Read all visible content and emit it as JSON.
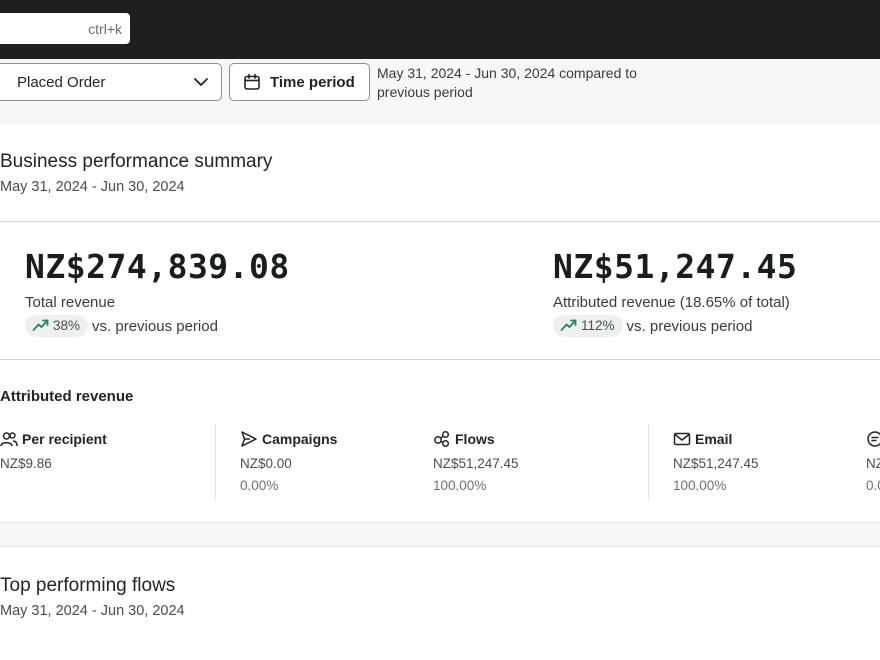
{
  "search": {
    "shortcut": "ctrl+k"
  },
  "filters": {
    "metric_label": "Placed Order",
    "time_button_label": "Time period",
    "period_description": "May 31, 2024 - Jun 30, 2024 compared to previous period"
  },
  "summary": {
    "title": "Business performance summary",
    "date_range": "May 31, 2024 - Jun 30, 2024",
    "total": {
      "amount": "NZ$274,839.08",
      "label": "Total revenue",
      "change": "38%",
      "change_suffix": "vs. previous period"
    },
    "attributed": {
      "amount": "NZ$51,247.45",
      "label": "Attributed revenue (18.65% of total)",
      "change": "112%",
      "change_suffix": "vs. previous period"
    },
    "trend_color": "#1a8a5a",
    "attributed_section": {
      "title": "Attributed revenue",
      "stats": [
        {
          "icon": "people-icon",
          "label": "Per recipient",
          "value": "NZ$9.86",
          "percent": ""
        },
        {
          "icon": "send-icon",
          "label": "Campaigns",
          "value": "NZ$0.00",
          "percent": "0.00%"
        },
        {
          "icon": "flows-icon",
          "label": "Flows",
          "value": "NZ$51,247.45",
          "percent": "100.00%"
        },
        {
          "icon": "mail-icon",
          "label": "Email",
          "value": "NZ$51,247.45",
          "percent": "100.00%"
        },
        {
          "icon": "sms-icon",
          "label": "",
          "value": "NZ",
          "percent": "0.0"
        }
      ]
    }
  },
  "flows": {
    "title": "Top performing flows",
    "date_range": "May 31, 2024 - Jun 30, 2024"
  }
}
